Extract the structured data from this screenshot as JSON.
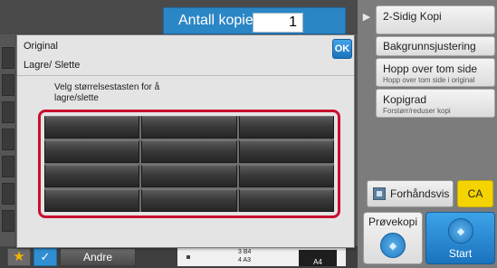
{
  "copies": {
    "label": "Antall kopier",
    "value": "1"
  },
  "menu": [
    {
      "title": "2-Sidig Kopi",
      "subtitle": ""
    },
    {
      "title": "Bakgrunnsjustering",
      "subtitle": ""
    },
    {
      "title": "Hopp over tom side",
      "subtitle": "Hopp over tom side i original"
    },
    {
      "title": "Kopigrad",
      "subtitle": "Forstørr/reduser kopi"
    }
  ],
  "preview_label": "Forhåndsvis",
  "ca_label": "CA",
  "proof_label": "Prøvekopi",
  "start_label": "Start",
  "dialog": {
    "title": "Original",
    "subtitle": "Lagre/ Slette",
    "ok_label": "OK",
    "instruction": "Velg størrelsestasten for å lagre/slette",
    "grid_rows": 4,
    "grid_cols": 3
  },
  "bottom": {
    "andre_label": "Andre",
    "tray_lines": [
      "3    B4",
      "4    A3"
    ],
    "paper_size": "A4"
  },
  "colors": {
    "accent_blue": "#2b86c5",
    "highlight_red": "#c8102e",
    "ca_yellow": "#f5d300"
  }
}
